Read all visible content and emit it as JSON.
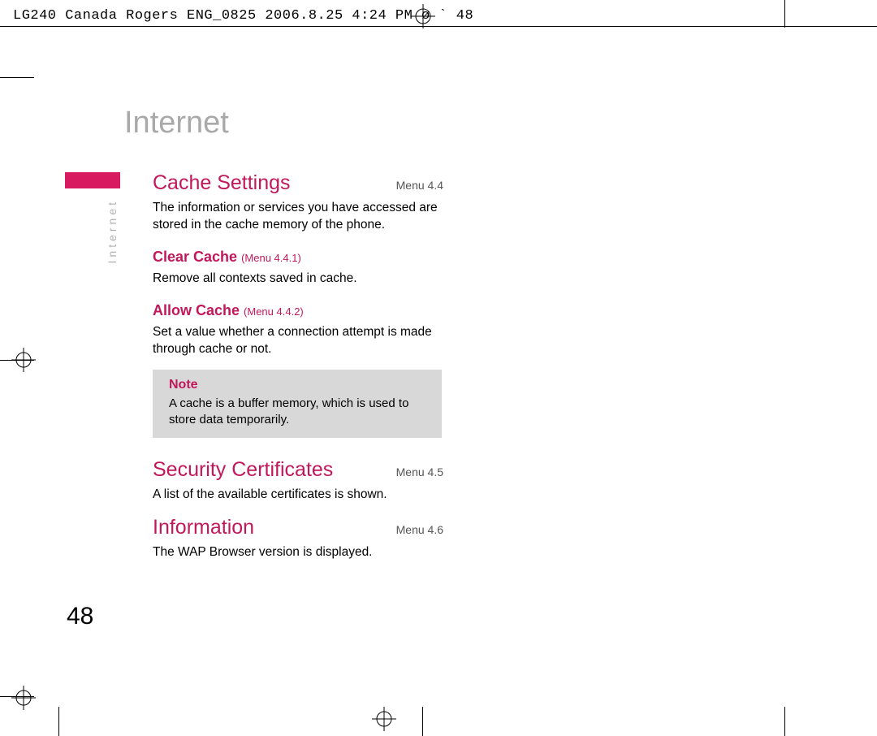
{
  "header": "LG240 Canada Rogers ENG_0825  2006.8.25 4:24 PM  ø   ` 48",
  "chapter_title": "Internet",
  "side_label": "Internet",
  "page_number": "48",
  "sections": {
    "cache": {
      "title": "Cache Settings",
      "menu": "Menu 4.4",
      "intro": "The information or services you have accessed are stored in the cache memory of the phone.",
      "clear": {
        "title": "Clear Cache",
        "menu": "(Menu 4.4.1)",
        "text": "Remove all contexts saved in cache."
      },
      "allow": {
        "title": "Allow Cache",
        "menu": "(Menu 4.4.2)",
        "text": "Set a value whether a connection attempt is made through cache or not."
      },
      "note": {
        "title": "Note",
        "text": "A cache is a buffer memory, which is used to store data temporarily."
      }
    },
    "security": {
      "title": "Security Certificates",
      "menu": "Menu 4.5",
      "text": "A list of the available certificates is shown."
    },
    "information": {
      "title": "Information",
      "menu": "Menu 4.6",
      "text": "The WAP Browser version is displayed."
    }
  }
}
